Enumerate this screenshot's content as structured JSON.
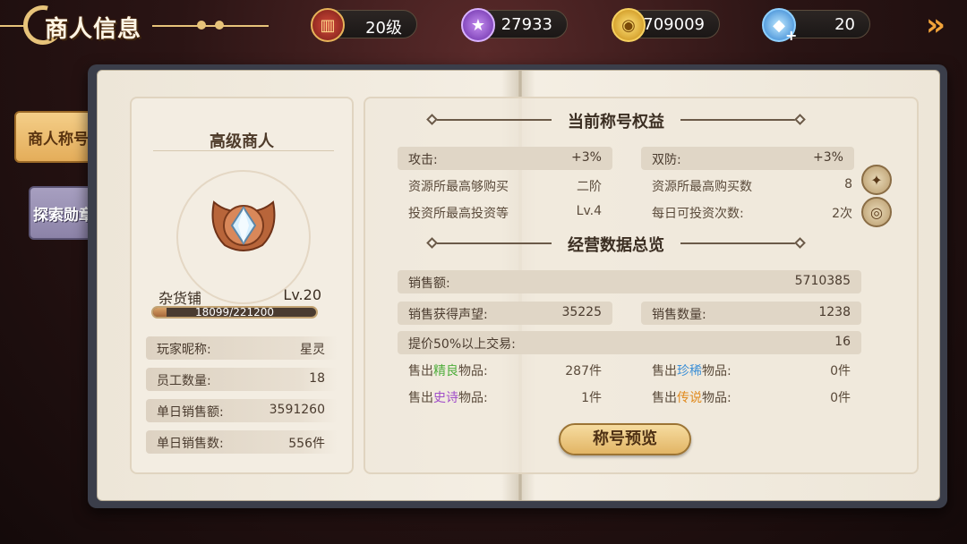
{
  "header": {
    "title": "商人信息",
    "resources": [
      {
        "name": "level",
        "icon": "shop-building-icon",
        "value": "20级"
      },
      {
        "name": "reputation",
        "icon": "purple-star-medal-icon",
        "value": "27933"
      },
      {
        "name": "gold",
        "icon": "gold-coin-icon",
        "value": "709009"
      },
      {
        "name": "diamond",
        "icon": "blue-diamond-icon",
        "value": "20"
      }
    ]
  },
  "tabs": [
    {
      "label": "商人称号",
      "active": true
    },
    {
      "label": "探索勋章",
      "active": false
    }
  ],
  "profile": {
    "rank_title": "高级商人",
    "shop_name": "杂货铺",
    "shop_level": "Lv.20",
    "xp_current": 18099,
    "xp_max": 221200,
    "xp_text": "18099/221200",
    "rows": [
      {
        "label": "玩家昵称:",
        "value": "星灵"
      },
      {
        "label": "员工数量:",
        "value": "18"
      },
      {
        "label": "单日销售额:",
        "value": "3591260"
      },
      {
        "label": "单日销售数:",
        "value": "556件"
      }
    ]
  },
  "benefits": {
    "heading": "当前称号权益",
    "left": [
      {
        "label": "攻击:",
        "value": "+3%"
      },
      {
        "label": "资源所最高够购买",
        "value": "二阶"
      },
      {
        "label": "投资所最高投资等",
        "value": "Lv.4"
      }
    ],
    "right": [
      {
        "label": "双防:",
        "value": "+3%"
      },
      {
        "label": "资源所最高购买数",
        "value": "8"
      },
      {
        "label": "每日可投资次数:",
        "value": "2次"
      }
    ]
  },
  "stats": {
    "heading": "经营数据总览",
    "sales_amount": {
      "label": "销售额:",
      "value": "5710385"
    },
    "reputation_gain": {
      "label": "销售获得声望:",
      "value": "35225"
    },
    "sales_count": {
      "label": "销售数量:",
      "value": "1238"
    },
    "premium_trades": {
      "label": "提价50%以上交易:",
      "value": "16"
    },
    "quality_items": [
      {
        "prefix": "售出",
        "tier": "精良",
        "suffix": "物品:",
        "value": "287件",
        "color": "#4fae3c"
      },
      {
        "prefix": "售出",
        "tier": "珍稀",
        "suffix": "物品:",
        "value": "0件",
        "color": "#3c8fd6"
      },
      {
        "prefix": "售出",
        "tier": "史诗",
        "suffix": "物品:",
        "value": "1件",
        "color": "#a14fc9"
      },
      {
        "prefix": "售出",
        "tier": "传说",
        "suffix": "物品:",
        "value": "0件",
        "color": "#e08a1e"
      }
    ]
  },
  "preview_button": "称号预览"
}
